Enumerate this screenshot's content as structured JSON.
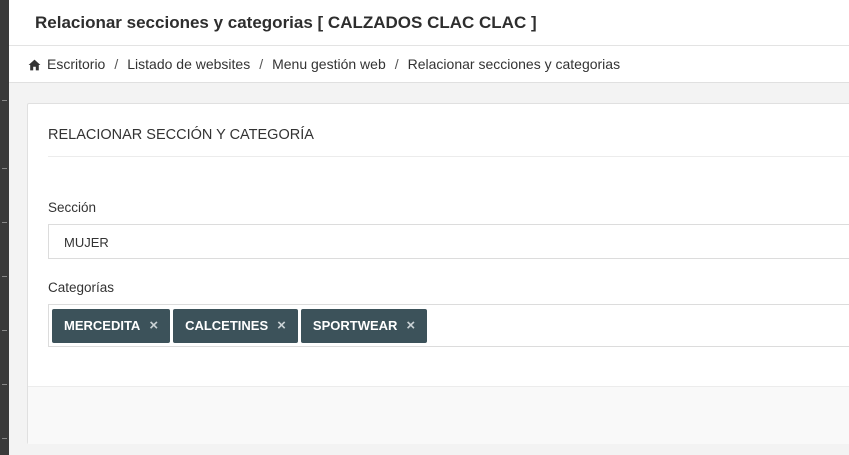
{
  "header": {
    "title": "Relacionar secciones y categorias [ CALZADOS CLAC CLAC ]"
  },
  "breadcrumb": {
    "icon": "home-icon",
    "items": [
      {
        "label": "Escritorio"
      },
      {
        "label": "Listado de websites"
      },
      {
        "label": "Menu gestión web"
      },
      {
        "label": "Relacionar secciones y categorias"
      }
    ],
    "separator": "/"
  },
  "panel": {
    "heading": "RELACIONAR SECCIÓN Y CATEGORÍA",
    "seccion": {
      "label": "Sección",
      "value": "MUJER"
    },
    "categorias": {
      "label": "Categorías",
      "tags": [
        {
          "label": "MERCEDITA",
          "remove": "×"
        },
        {
          "label": "CALCETINES",
          "remove": "×"
        },
        {
          "label": "SPORTWEAR",
          "remove": "×"
        }
      ]
    }
  },
  "colors": {
    "tag_background": "#3c525a",
    "page_background": "#f3f3f3",
    "sidebar_strip": "#3a3a3a"
  }
}
